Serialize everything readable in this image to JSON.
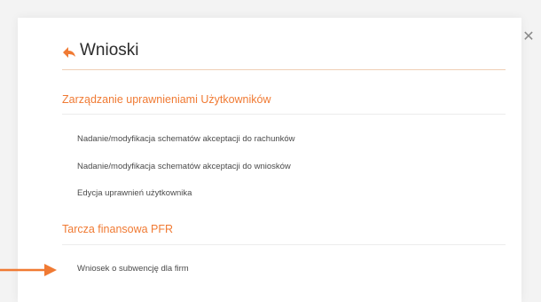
{
  "colors": {
    "accent": "#f07a33",
    "title": "#2c2c2c",
    "link": "#4a4a4a",
    "divider": "#ececec",
    "close": "#8a8a8a"
  },
  "header": {
    "title": "Wnioski",
    "back_icon": "back-arrow-icon"
  },
  "close_icon": "close-icon",
  "sections": [
    {
      "title": "Zarządzanie uprawnieniami Użytkowników",
      "items": [
        "Nadanie/modyfikacja schematów akceptacji do rachunków",
        "Nadanie/modyfikacja schematów akceptacji do wniosków",
        "Edycja uprawnień użytkownika"
      ]
    },
    {
      "title": "Tarcza finansowa PFR",
      "items": [
        "Wniosek o subwencję dla firm"
      ]
    }
  ],
  "annotation_icon": "pointer-arrow-icon"
}
